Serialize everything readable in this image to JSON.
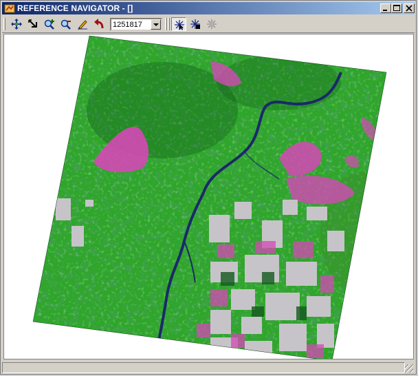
{
  "window": {
    "title": "REFERENCE NAVIGATOR - []"
  },
  "title_controls": [
    "minimize-icon",
    "maximize-icon",
    "close-icon"
  ],
  "toolbar": {
    "tools": [
      {
        "name": "pan",
        "icon": "pan-icon"
      },
      {
        "name": "zoom-to-extent",
        "icon": "zoom-extent-icon"
      },
      {
        "name": "zoom-in",
        "icon": "zoom-in-icon"
      },
      {
        "name": "zoom-out",
        "icon": "zoom-out-icon"
      },
      {
        "name": "draw",
        "icon": "pencil-icon"
      },
      {
        "name": "back",
        "icon": "back-arrow-icon"
      }
    ],
    "scale": {
      "value": "1251817"
    },
    "nav_tools": [
      {
        "name": "navigator-a",
        "icon": "navigator-cursor-icon",
        "pressed": true
      },
      {
        "name": "navigator-b",
        "icon": "navigator-move-icon",
        "pressed": false
      },
      {
        "name": "navigator-c",
        "icon": "navigator-disabled-icon",
        "pressed": false,
        "disabled": true
      }
    ]
  },
  "canvas": {
    "content": "satellite-image",
    "colors": {
      "forest": "#2fa52b",
      "forest_dark": "#0f5a16",
      "clearing": "#d548b6",
      "bare": "#c7c4c9",
      "river": "#1a2a68",
      "background": "#ffffff"
    }
  },
  "statusbar": {
    "text": ""
  }
}
